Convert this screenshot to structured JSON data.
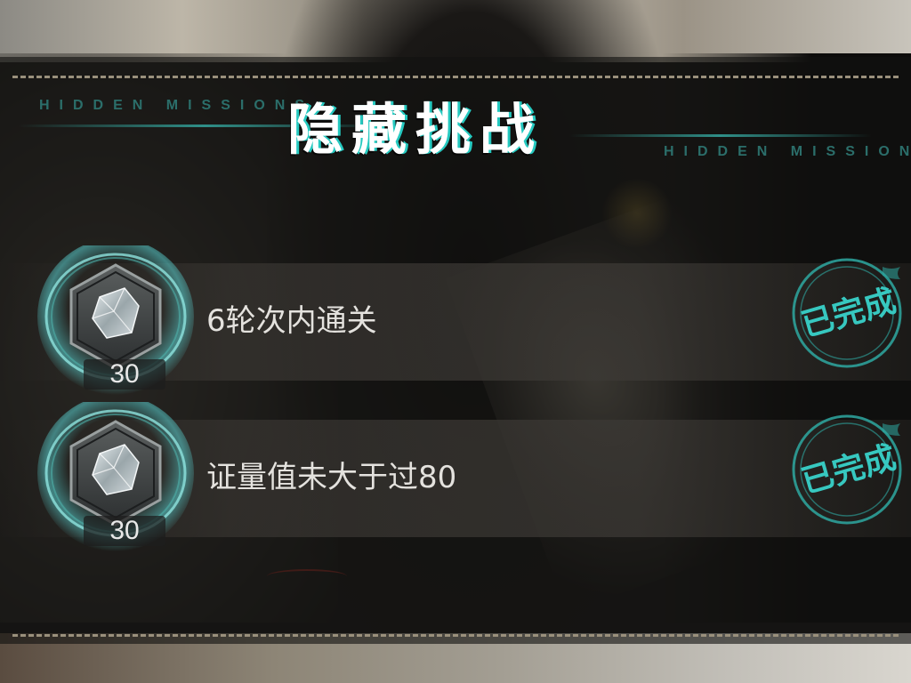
{
  "header": {
    "title": "隐藏挑战",
    "subtitle_left": "HIDDEN MISSIONS",
    "subtitle_right": "HIDDEN MISSIONS"
  },
  "missions": [
    {
      "description": "6轮次内通关",
      "reward_count": "30",
      "reward_icon": "crystal-shard-icon",
      "status": "已完成"
    },
    {
      "description": "证量值未大于过80",
      "reward_count": "30",
      "reward_icon": "crystal-shard-icon",
      "status": "已完成"
    }
  ],
  "colors": {
    "accent": "#37c8c0",
    "title": "#ffffff",
    "text": "#e4e2de",
    "dash": "#9a907c"
  }
}
